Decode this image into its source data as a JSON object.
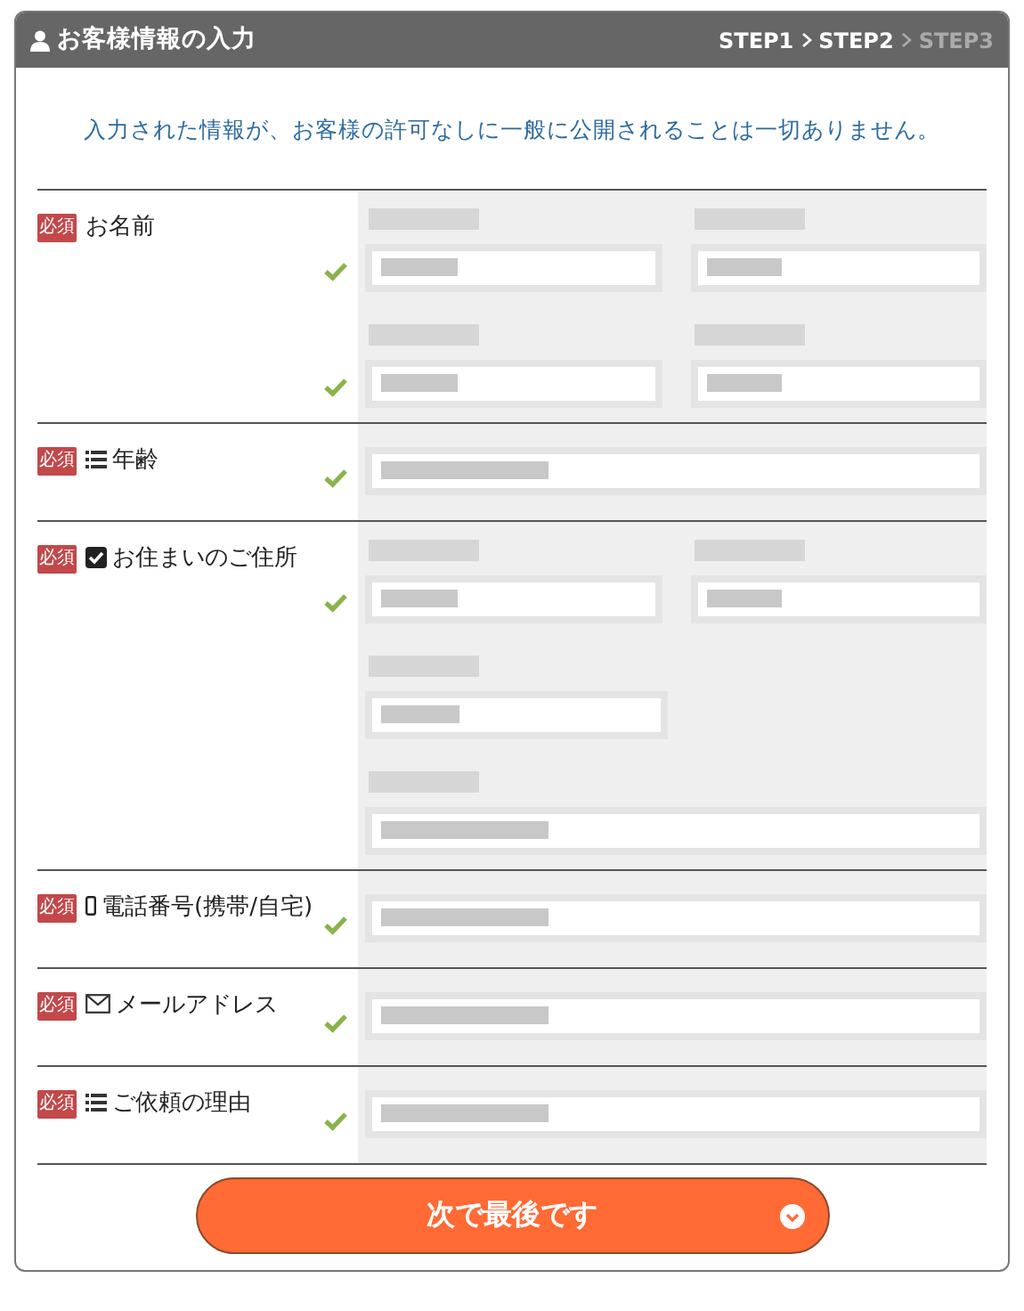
{
  "header": {
    "title": "お客様情報の入力",
    "steps": [
      {
        "label": "STEP1",
        "reached": true
      },
      {
        "label": "STEP2",
        "reached": true
      },
      {
        "label": "STEP3",
        "reached": false
      }
    ]
  },
  "notice": "入力された情報が、お客様の許可なしに一般に公開されることは一切ありません。",
  "sections": [
    {
      "label": "お名前",
      "badge": "必須",
      "kind": "plain",
      "groups": [
        {
          "kind": "labeled_pair",
          "valid": true
        },
        {
          "kind": "labeled_pair",
          "valid": true
        }
      ]
    },
    {
      "label": "年齢",
      "badge": "必須",
      "kind": "list",
      "groups": [
        {
          "kind": "single",
          "valid": true
        }
      ]
    },
    {
      "label": "お住まいのご住所",
      "badge": "必須",
      "kind": "checkbox",
      "groups": [
        {
          "kind": "labeled_pair",
          "valid": true
        },
        {
          "kind": "labeled_short",
          "valid": false
        },
        {
          "kind": "labeled_single",
          "valid": false
        }
      ]
    },
    {
      "label": "電話番号(携帯/自宅)",
      "badge": "必須",
      "kind": "phone",
      "groups": [
        {
          "kind": "single",
          "valid": true
        }
      ]
    },
    {
      "label": "メールアドレス",
      "badge": "必須",
      "kind": "mail",
      "groups": [
        {
          "kind": "single",
          "valid": true
        }
      ]
    },
    {
      "label": "ご依頼の理由",
      "badge": "必須",
      "kind": "list",
      "groups": [
        {
          "kind": "single",
          "valid": true
        }
      ]
    }
  ],
  "submit": {
    "label": "次で最後です"
  }
}
